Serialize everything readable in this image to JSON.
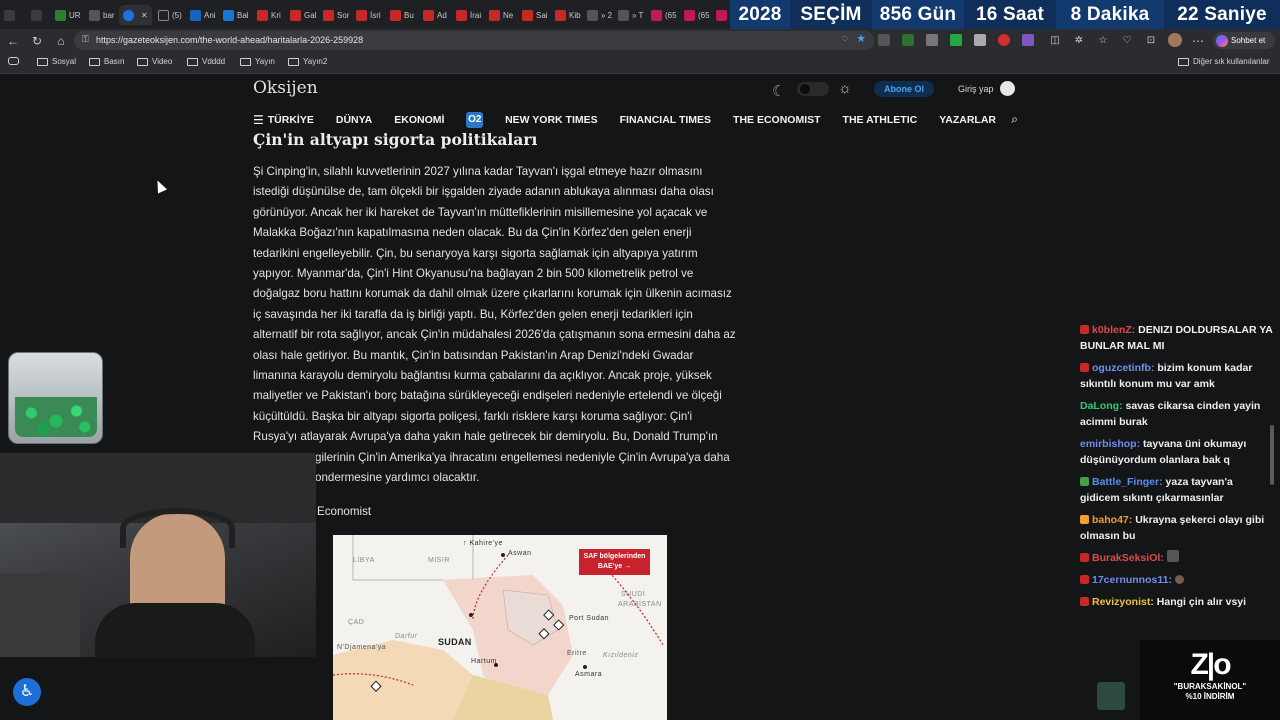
{
  "tabs": [
    {
      "label": "UR",
      "color": "#2e7d32"
    },
    {
      "label": "bar",
      "color": "#555"
    },
    {
      "label": "",
      "color": "#1a73e8",
      "active": true
    },
    {
      "label": "(5)",
      "color": "#222"
    },
    {
      "label": "Ani",
      "color": "#1565c0"
    },
    {
      "label": "Bal",
      "color": "#1976d2"
    },
    {
      "label": "Kri",
      "color": "#c62828"
    },
    {
      "label": "Gal",
      "color": "#c62828"
    },
    {
      "label": "Sor",
      "color": "#c62828"
    },
    {
      "label": "İsri",
      "color": "#c62828"
    },
    {
      "label": "Bu",
      "color": "#c62828"
    },
    {
      "label": "Ad",
      "color": "#c62828"
    },
    {
      "label": "İrai",
      "color": "#c62828"
    },
    {
      "label": "Ne",
      "color": "#c62828"
    },
    {
      "label": "Sai",
      "color": "#c62828"
    },
    {
      "label": "Kib",
      "color": "#c62828"
    },
    {
      "label": "» 2",
      "color": "#555"
    },
    {
      "label": "» T",
      "color": "#555"
    },
    {
      "label": "(65",
      "color": "#c2185b"
    },
    {
      "label": "(65",
      "color": "#c2185b"
    }
  ],
  "countdown": {
    "year": "2028",
    "title": "SEÇİM",
    "days": "856",
    "days_unit": "Gün",
    "hours": "16",
    "hours_unit": "Saat",
    "minutes": "8",
    "minutes_unit": "Dakika",
    "seconds": "22",
    "seconds_unit": "Saniye"
  },
  "address": {
    "url": "https://gazeteoksijen.com/the-world-ahead/haritalarla-2026-259928"
  },
  "toolbar": {
    "chat_label": "Sohbet et"
  },
  "bookmarks": [
    "Sosyal",
    "Basın",
    "Video",
    "Vdddd",
    "Yayın",
    "Yayın2"
  ],
  "bookmarks_other": "Diğer sık kullanılanlar",
  "site": {
    "logo": "Oksijen",
    "subscribe": "Abone Ol",
    "login": "Giriş yap",
    "nav": [
      "TÜRKİYE",
      "DÜNYA",
      "EKONOMİ",
      "NEW YORK TIMES",
      "FINANCIAL TIMES",
      "THE ECONOMIST",
      "THE ATHLETIC",
      "YAZARLAR"
    ],
    "o2_label": "O2"
  },
  "article": {
    "heading": "Çin'in altyapı sigorta politikaları",
    "lines": [
      "Şi Cinping'in, silahlı kuvvetlerinin 2027 yılına kadar Tayvan'ı işgal etmeye hazır olmasını",
      "istediği düşünülse de, tam ölçekli bir işgalden ziyade adanın ablukaya alınması daha olası",
      "görünüyor. Ancak her iki hareket de Tayvan'ın müttefiklerinin misillemesine yol açacak ve",
      "Malakka Boğazı'nın kapatılmasına neden olacak. Bu da Çin'in Körfez'den gelen enerji",
      "tedarikini engelleyebilir. Çin, bu senaryoya karşı sigorta sağlamak için altyapıya yatırım",
      "yapıyor. Myanmar'da, Çin'i Hint Okyanusu'na bağlayan 2 bin 500 kilometrelik petrol ve",
      "doğalgaz boru hattını korumak da dahil olmak üzere çıkarlarını korumak için ülkenin acımasız",
      "iç savaşında her iki tarafla da iş birliği yaptı. Bu, Körfez'den gelen enerji tedarikleri için",
      "alternatif bir rota sağlıyor, ancak Çin'in müdahalesi 2026'da çatışmanın sona ermesini daha az",
      "olası hale getiriyor. Bu mantık, Çin'in batısından Pakistan'ın Arap Denizi'ndeki Gwadar",
      "limanına karayolu demiryolu bağlantısı kurma çabalarını da açıklıyor. Ancak proje, yüksek",
      "maliyetler ve Pakistan'ı borç batağına sürükleyeceği endişeleri nedeniyle ertelendi ve ölçeği",
      "küçültüldü. Başka bir altyapı sigorta poliçesi, farklı risklere karşı koruma sağlıyor: Çin'i",
      "Rusya'yı atlayarak Avrupa'ya daha yakın hale getirecek bir demiryolu. Bu, Donald Trump'ın",
      "gilerinin Çin'in Amerika'ya ihracatını engellemesi nedeniyle Çin'in Avrupa'ya daha",
      "ondermesine yardımcı olacaktır."
    ],
    "source": "Economist"
  },
  "map": {
    "saf_label_1": "SAF bölgelerinden",
    "saf_label_2": "BAE'ye →",
    "labels": {
      "libya": "LİBYA",
      "misir": "MISIR",
      "kahire": "↑ Kahire'ye",
      "aswan": "Aswan",
      "suudi": "SUUDİ",
      "arabistan": "ARABİSTAN",
      "cad": "ÇAD",
      "darfur": "Darfur",
      "sudan": "SUDAN",
      "port_sudan": "Port Sudan",
      "eritre": "Eritre",
      "kizildeniz": "Kızıldeniz",
      "ndjamena": "N'Djamena'ya",
      "hartum": "Hartum",
      "asmara": "Asmara"
    }
  },
  "chat": [
    {
      "user": "k0blenZ:",
      "text": "DENIZI DOLDURSALAR YA BUNLAR MAL MI",
      "user_color": "#e04a4a",
      "badge": "#c62828"
    },
    {
      "user": "oguzcetinfb:",
      "text": "bizim konum kadar sıkıntılı konum mu var amk",
      "user_color": "#6f8ff0",
      "badge": "#c62828"
    },
    {
      "user": "DaLong:",
      "text": "savas cikarsa cinden yayin acimmi burak",
      "user_color": "#2ecc71",
      "badge": ""
    },
    {
      "user": "emirbishop:",
      "text": "tayvana üni okumayı düşünüyordum olanlara bak q",
      "user_color": "#6f8ff0",
      "badge": ""
    },
    {
      "user": "Battle_Finger:",
      "text": "yaza tayvan'a gidicem sıkıntı çıkarmasınlar",
      "user_color": "#5b8df0",
      "badge": "#43a047"
    },
    {
      "user": "baho47:",
      "text": "Ukrayna şekerci olayı gibi olmasın bu",
      "user_color": "#f0a030",
      "badge": "#f0a030"
    },
    {
      "user": "BurakSeksiOl:",
      "text": "",
      "user_color": "#e04a4a",
      "badge": "#c62828"
    },
    {
      "user": "17cernunnos11:",
      "text": "",
      "user_color": "#6f8ff0",
      "badge": "#c62828"
    },
    {
      "user": "Revizyonist:",
      "text": "Hangi çin alır vsyi",
      "user_color": "#f0c040",
      "badge": "#c62828"
    }
  ],
  "promo": {
    "text1": "\"BURAKSAKİNOL\"",
    "text2": "%10 İNDİRİM"
  }
}
